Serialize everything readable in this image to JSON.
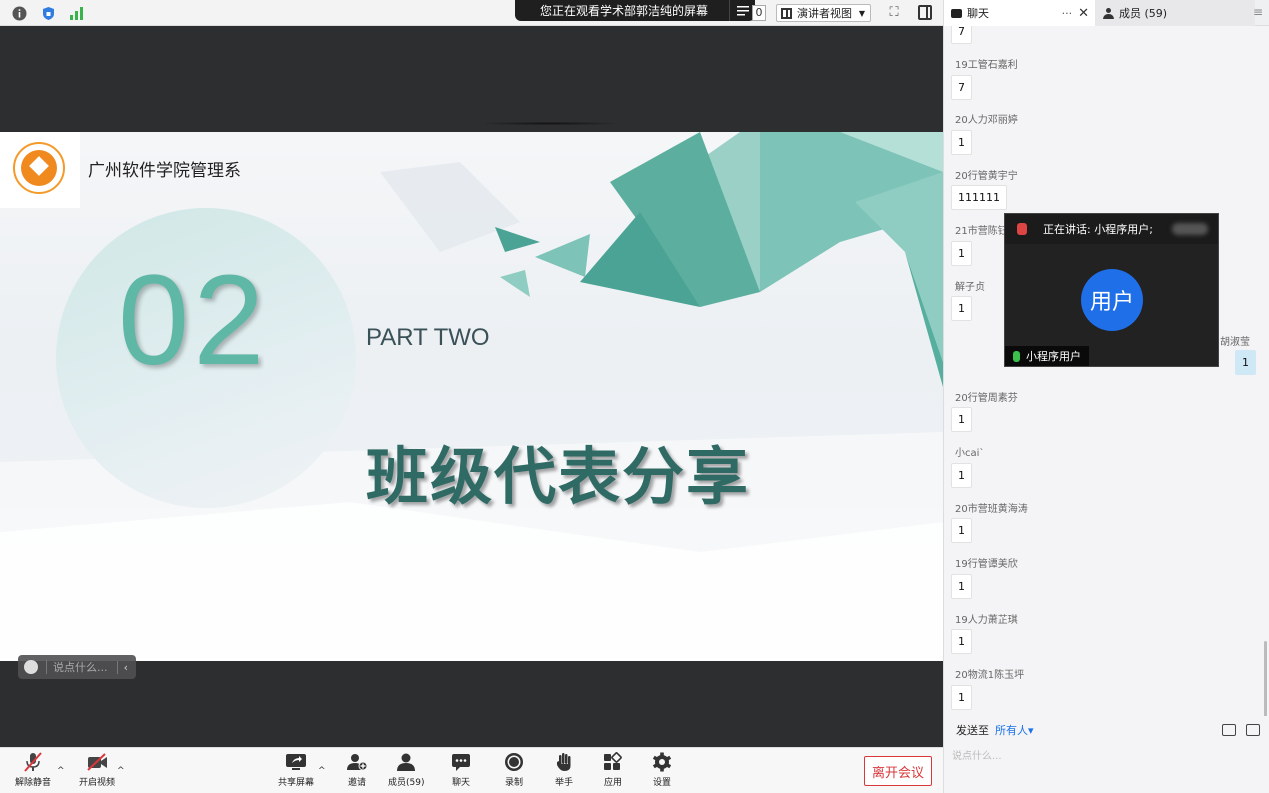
{
  "share_banner": "您正在观看学术部郭洁纯的屏幕",
  "zoom_value": "0",
  "view_button": "演讲者视图",
  "slide": {
    "school_name": "广州软件学院管理系",
    "number": "02",
    "part": "PART TWO",
    "title": "班级代表分享"
  },
  "chat_overlay_placeholder": "说点什么...",
  "toolbar": {
    "mute": "解除静音",
    "video": "开启视频",
    "share": "共享屏幕",
    "invite": "邀请",
    "members": "成员(59)",
    "chat": "聊天",
    "record": "录制",
    "raise_hand": "举手",
    "apps": "应用",
    "settings": "设置",
    "leave": "离开会议"
  },
  "panel": {
    "chat_tab": "聊天",
    "more": "···",
    "close": "✕",
    "members_tab": "成员 (59)",
    "menu": "≡"
  },
  "chat": {
    "top_msg": "7",
    "items": [
      {
        "name": "19工管石嘉利",
        "msg": "7"
      },
      {
        "name": "20人力邓丽婷",
        "msg": "1"
      },
      {
        "name": "20行管黄宇宁",
        "msg": "111111"
      },
      {
        "name": "21市营陈钰",
        "msg": "1"
      },
      {
        "name": "解子贞",
        "msg": "1"
      },
      {
        "name": "20行管周素芬",
        "msg": "1"
      },
      {
        "name": "小cai`",
        "msg": "1"
      },
      {
        "name": "20市营班黄海涛",
        "msg": "1"
      },
      {
        "name": "19行管谭美欣",
        "msg": "1"
      },
      {
        "name": "19人力萧芷琪",
        "msg": "1"
      },
      {
        "name": "20物流1陈玉坪",
        "msg": "1"
      }
    ],
    "highlight_name": "胡淑莹",
    "highlight_msg": "1"
  },
  "send_to_label": "发送至",
  "send_to_target": "所有人▾",
  "input_placeholder": "说点什么...",
  "speaker": {
    "speaking": "正在讲话: 小程序用户;",
    "avatar": "用户",
    "name": "小程序用户"
  }
}
